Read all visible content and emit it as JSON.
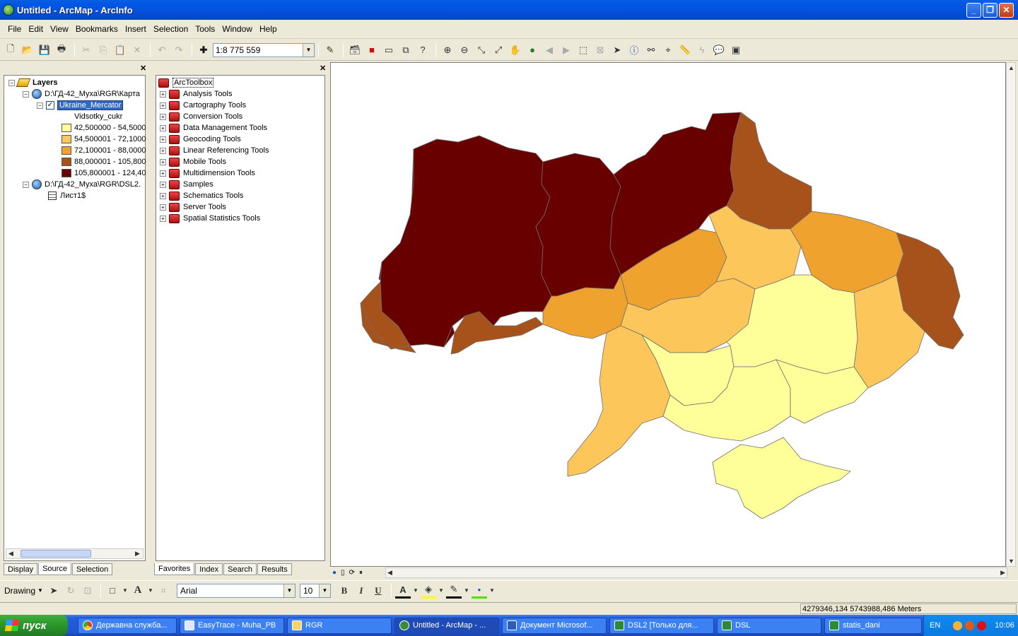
{
  "window": {
    "title": "Untitled - ArcMap - ArcInfo"
  },
  "menu": [
    "File",
    "Edit",
    "View",
    "Bookmarks",
    "Insert",
    "Selection",
    "Tools",
    "Window",
    "Help"
  ],
  "toolbar": {
    "scale": "1:8 775 559"
  },
  "toc": {
    "root": "Layers",
    "frame1_path": "D:\\ГД-42_Муха\\RGR\\Карта",
    "layer_name": "Ukraine_Mercator",
    "field_name": "Vidsotky_cukr",
    "classes": [
      {
        "label": "42,500000 - 54,5000",
        "color": "#ffff99"
      },
      {
        "label": "54,500001 - 72,1000",
        "color": "#fcc65a"
      },
      {
        "label": "72,100001 - 88,0000",
        "color": "#f0a22e"
      },
      {
        "label": "88,000001 - 105,800",
        "color": "#a8521b"
      },
      {
        "label": "105,800001 - 124,40",
        "color": "#680000"
      }
    ],
    "frame2_path": "D:\\ГД-42_Муха\\RGR\\DSL2.",
    "table_name": "Лист1$",
    "tabs": [
      "Display",
      "Source",
      "Selection"
    ],
    "active_tab": "Source"
  },
  "toolbox": {
    "root": "ArcToolbox",
    "items": [
      "Analysis Tools",
      "Cartography Tools",
      "Conversion Tools",
      "Data Management Tools",
      "Geocoding Tools",
      "Linear Referencing Tools",
      "Mobile Tools",
      "Multidimension Tools",
      "Samples",
      "Schematics Tools",
      "Server Tools",
      "Spatial Statistics Tools"
    ],
    "tabs": [
      "Favorites",
      "Index",
      "Search",
      "Results"
    ],
    "active_tab": "Favorites"
  },
  "drawing": {
    "label": "Drawing",
    "font": "Arial",
    "size": "10",
    "bold": "B",
    "italic": "I",
    "underline": "U"
  },
  "status": {
    "coords": "4279346,134  5743988,486 Meters"
  },
  "taskbar": {
    "start": "пуск",
    "tasks": [
      "Державна служба...",
      "EasyTrace - Muha_PB",
      "RGR",
      "Untitled - ArcMap - ...",
      "Документ Microsof...",
      "DSL2  [Только для...",
      "DSL",
      "statis_dani"
    ],
    "active_index": 3,
    "lang": "EN",
    "time": "10:06"
  }
}
